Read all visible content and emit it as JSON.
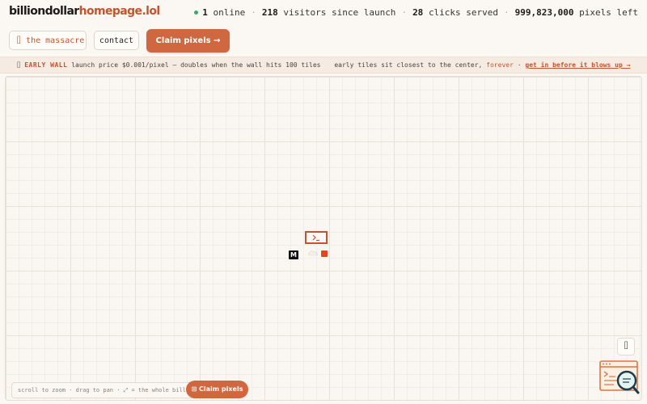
{
  "header": {
    "logo_main": "billiondollar",
    "logo_accent": "homepage.lol",
    "stats": {
      "online_count": "1",
      "online_label": "online",
      "visitors_count": "218",
      "visitors_label": "visitors since launch",
      "clicks_count": "28",
      "clicks_label": "clicks served",
      "pixels_count": "999,823,000",
      "pixels_label": "pixels left",
      "separator": "·"
    }
  },
  "nav": {
    "massacre_icon": "⌷",
    "massacre_label": "the massacre",
    "contact_label": "contact",
    "claim_label": "Claim pixels →"
  },
  "banner": {
    "icon": "⌷",
    "early_label": "EARLY WALL",
    "price_text": "launch price $0.001/pixel — doubles when the wall hits 100 tiles",
    "center_text": "early tiles sit closest to the center,",
    "forever": "forever",
    "separator": "·",
    "cta": "get in before it blows up →"
  },
  "canvas": {
    "tiles": [
      {
        "name": "terminal-tile",
        "icon": "terminal-icon",
        "color": "#c2542f"
      },
      {
        "name": "m-tile",
        "text": "M"
      },
      {
        "name": "cloud-tile",
        "icon": "cloud-icon"
      },
      {
        "name": "red-tile",
        "color": "#e2451c"
      }
    ]
  },
  "bottom": {
    "hint": "scroll to zoom · drag to pan · ⤢ = the whole billion",
    "claim_label": "⊞ Claim pixels"
  },
  "side": {
    "icon": "⌷"
  },
  "colors": {
    "accent": "#cf6740",
    "accent_text": "#c2542f",
    "online_dot": "#3aa76d",
    "background": "#fbf8f3"
  }
}
